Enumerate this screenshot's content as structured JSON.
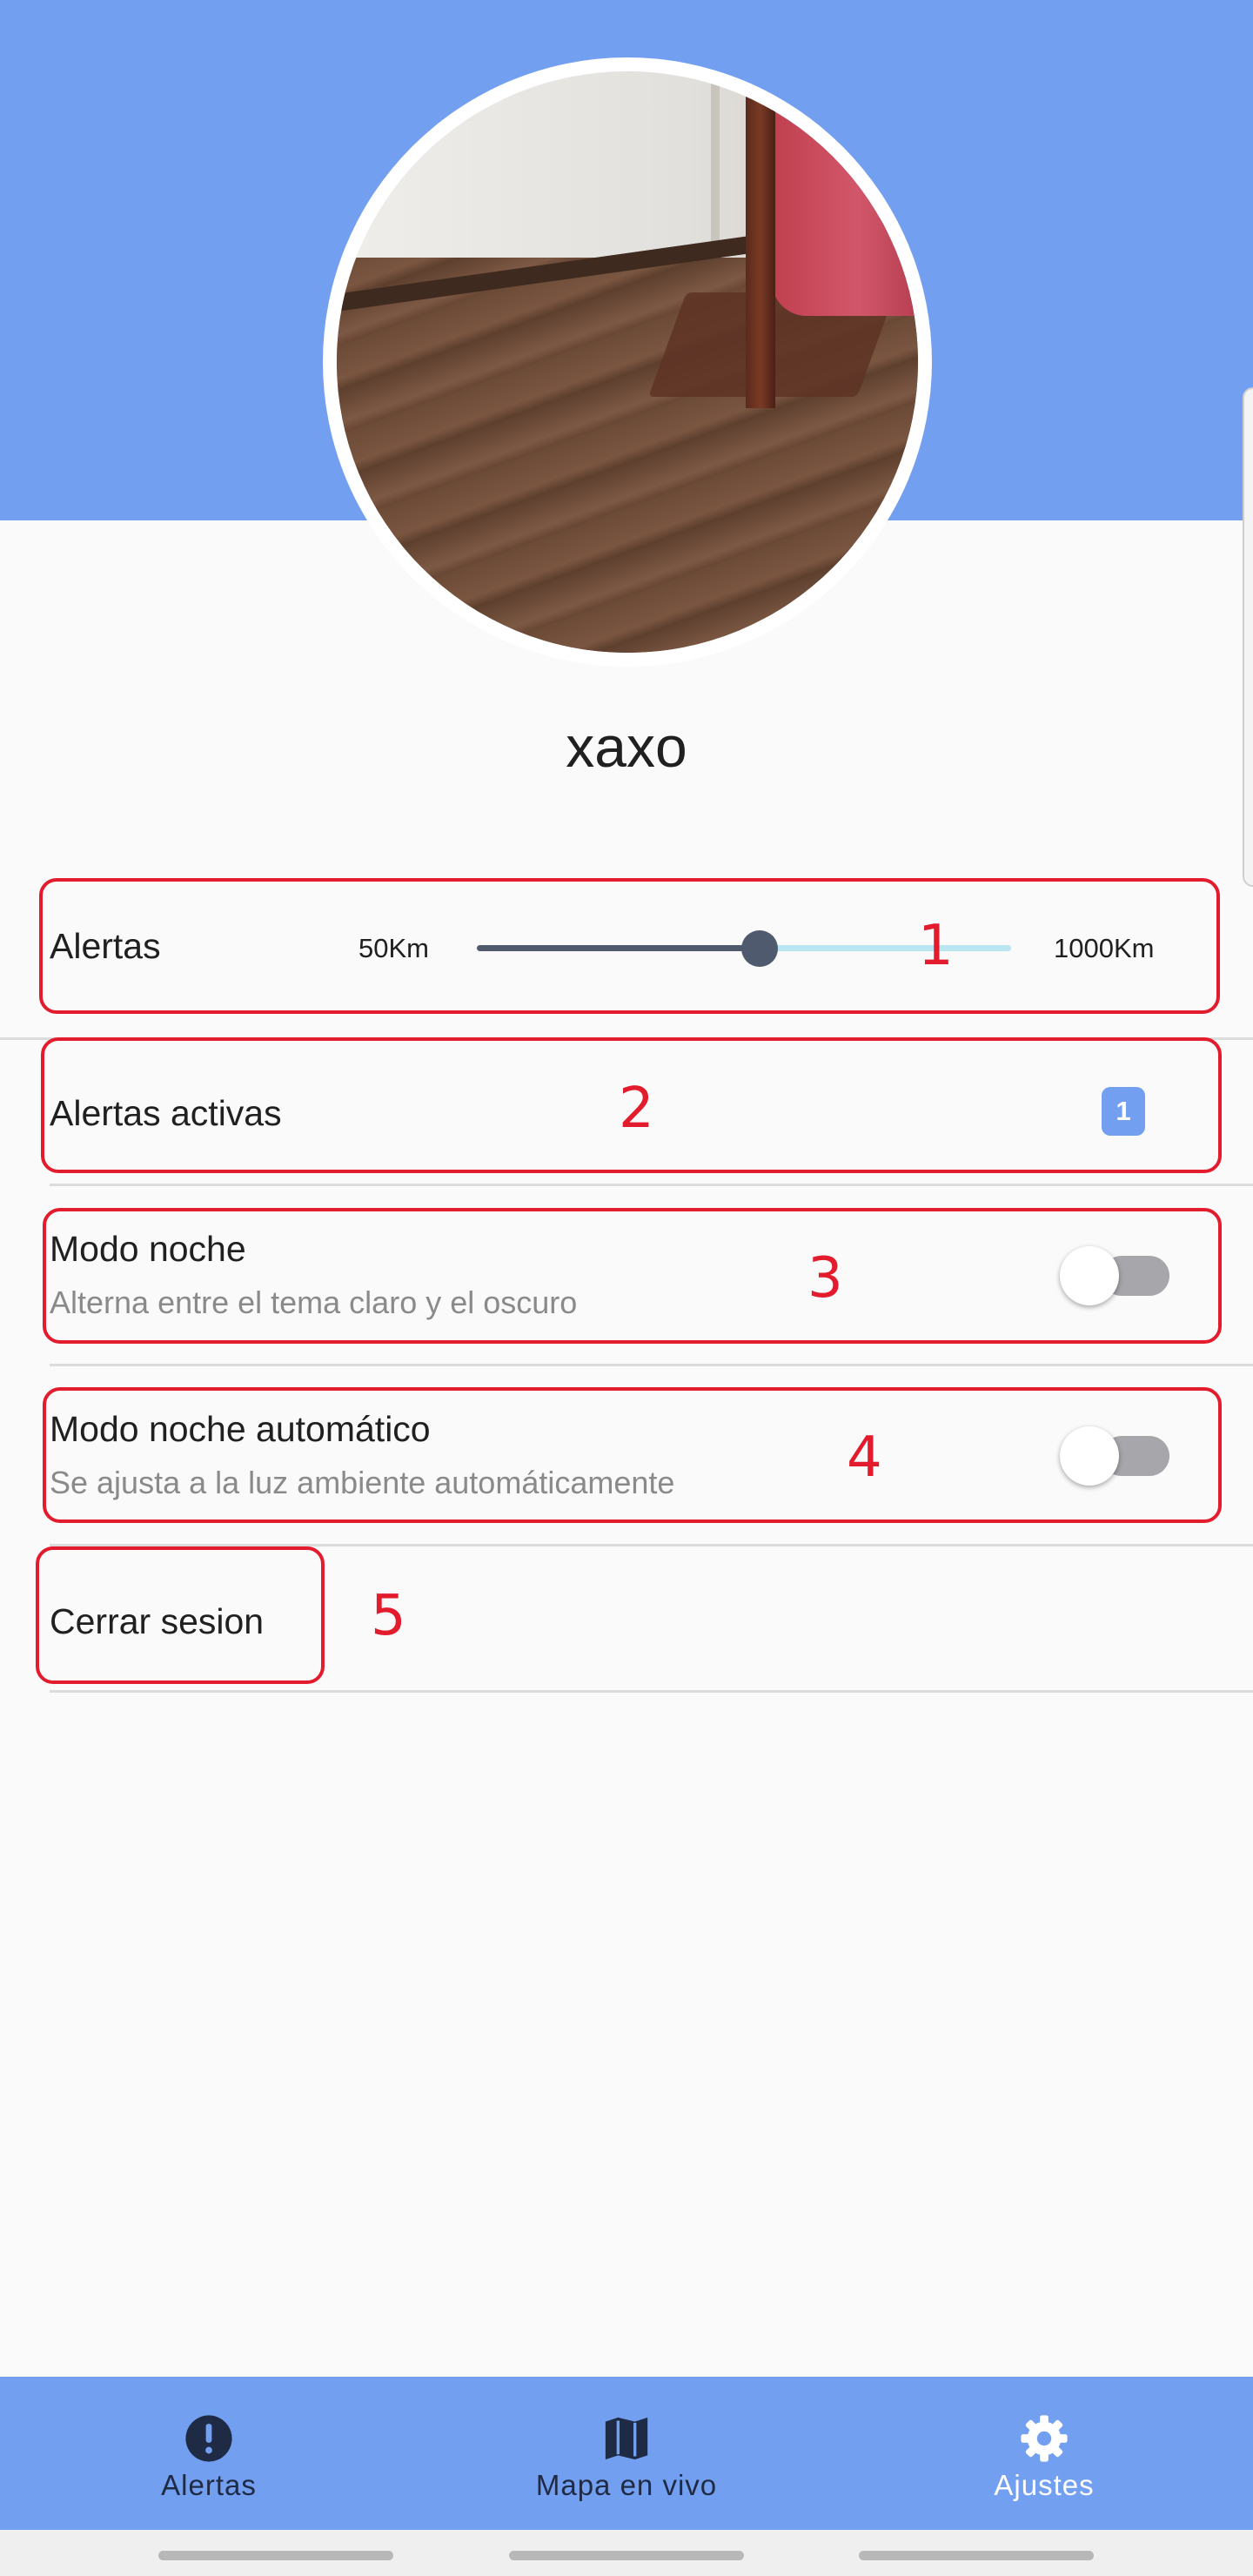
{
  "profile": {
    "username": "xaxo",
    "avatar_icon": "profile-photo"
  },
  "settings": {
    "alerts_radius": {
      "label": "Alertas",
      "min_label": "50Km",
      "max_label": "1000Km",
      "value_fraction": 0.53
    },
    "active_alerts": {
      "label": "Alertas activas",
      "count": "1"
    },
    "night_mode": {
      "title": "Modo noche",
      "subtitle": "Alterna entre el tema claro y el oscuro",
      "enabled": false
    },
    "auto_night_mode": {
      "title": "Modo noche automático",
      "subtitle": "Se ajusta a la luz ambiente automáticamente",
      "enabled": false
    },
    "logout": {
      "label": "Cerrar sesion"
    }
  },
  "annotations": [
    "1",
    "2",
    "3",
    "4",
    "5"
  ],
  "bottom_nav": [
    {
      "label": "Alertas",
      "icon": "alert-circle-icon",
      "active": false
    },
    {
      "label": "Mapa en vivo",
      "icon": "map-icon",
      "active": false
    },
    {
      "label": "Ajustes",
      "icon": "gear-icon",
      "active": true
    }
  ],
  "colors": {
    "primary": "#739ff0",
    "annotation": "#e21b2d",
    "nav_inactive": "#1f2a44",
    "nav_active": "#ffffff",
    "slider_active": "#505a6e",
    "slider_inactive": "#b9e6f0"
  }
}
